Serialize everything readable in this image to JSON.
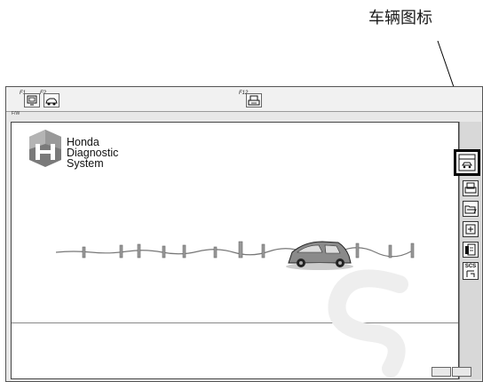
{
  "callout": {
    "label": "车辆图标"
  },
  "toolbar": {
    "f1_label": "F1",
    "f2_label": "F2",
    "f12_label": "F12",
    "small_label": "F/W"
  },
  "logo": {
    "line1": "Honda",
    "line2": "Diagnostic",
    "line3": "System"
  },
  "sidebar": {
    "icons": [
      "vehicle-icon",
      "print-icon",
      "open-folder-icon",
      "help-icon",
      "database-icon",
      "scs-icon"
    ],
    "scs_top": "SCS",
    "selected": "vehicle-icon"
  }
}
